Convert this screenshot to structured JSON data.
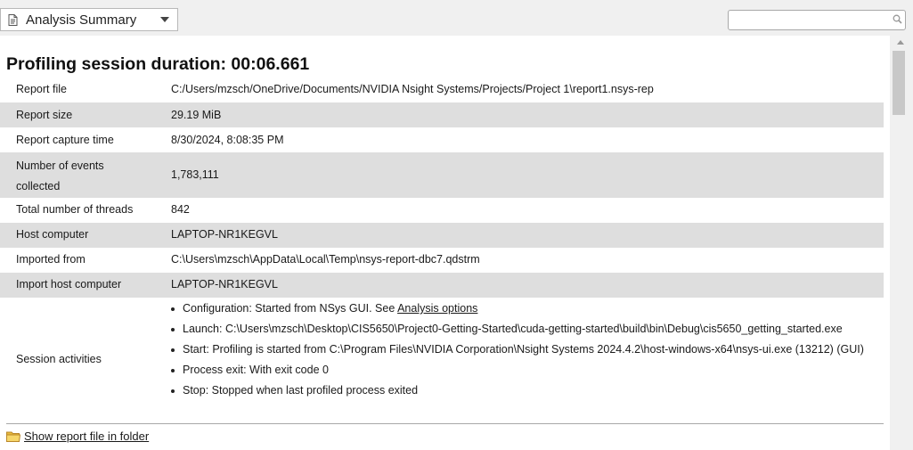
{
  "toolbar": {
    "view_label": "Analysis Summary",
    "search_value": ""
  },
  "summary": {
    "title": "Profiling session duration: 00:06.661",
    "rows": [
      {
        "key": "Report file",
        "value": "C:/Users/mzsch/OneDrive/Documents/NVIDIA Nsight Systems/Projects/Project 1\\report1.nsys-rep"
      },
      {
        "key": "Report size",
        "value": "29.19 MiB"
      },
      {
        "key": "Report capture time",
        "value": "8/30/2024, 8:08:35 PM"
      },
      {
        "key": "Number of events collected",
        "value": "1,783,111"
      },
      {
        "key": "Total number of threads",
        "value": "842"
      },
      {
        "key": "Host computer",
        "value": "LAPTOP-NR1KEGVL"
      },
      {
        "key": "Imported from",
        "value": "C:\\Users\\mzsch\\AppData\\Local\\Temp\\nsys-report-dbc7.qdstrm"
      },
      {
        "key": "Import host computer",
        "value": "LAPTOP-NR1KEGVL"
      }
    ],
    "session_activities": {
      "key": "Session activities",
      "config_prefix": "Configuration: Started from NSys GUI. See ",
      "config_link": "Analysis options",
      "items": [
        "Launch: C:\\Users\\mzsch\\Desktop\\CIS5650\\Project0-Getting-Started\\cuda-getting-started\\build\\bin\\Debug\\cis5650_getting_started.exe",
        "Start: Profiling is started from C:\\Program Files\\NVIDIA Corporation\\Nsight Systems 2024.4.2\\host-windows-x64\\nsys-ui.exe (13212) (GUI)",
        "Process exit: With exit code 0",
        "Stop: Stopped when last profiled process exited"
      ]
    },
    "folder_link": "Show report file in folder"
  }
}
